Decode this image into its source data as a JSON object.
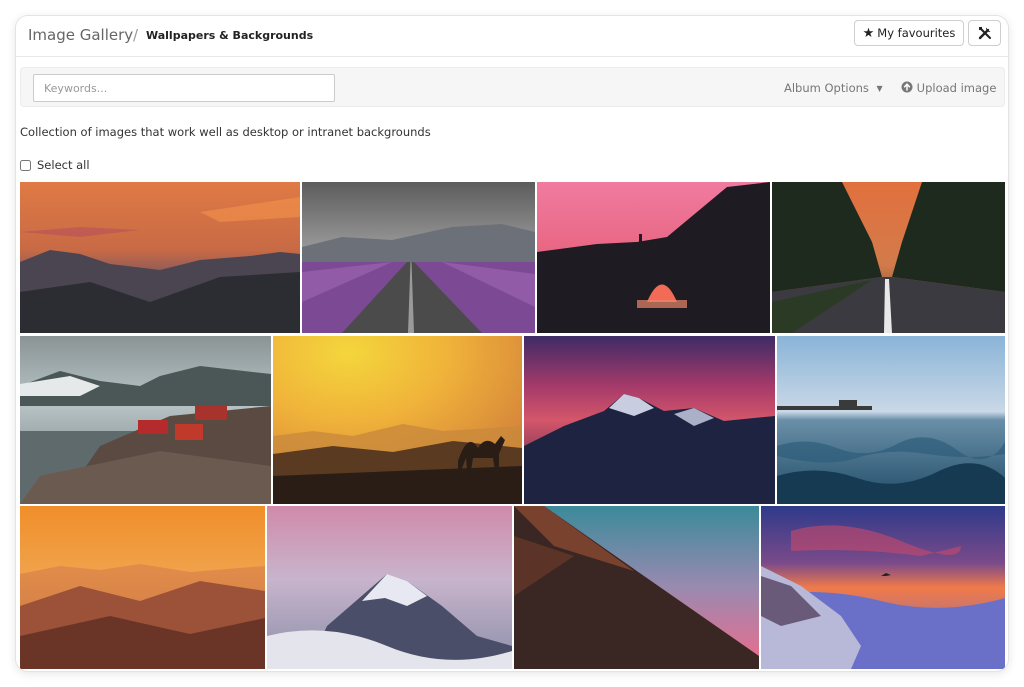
{
  "header": {
    "breadcrumb_root": "Image Gallery",
    "breadcrumb_separator": "/",
    "breadcrumb_current": "Wallpapers & Backgrounds",
    "favourites_label": "My favourites",
    "favourites_icon": "star-icon",
    "tools_icon": "tools-icon"
  },
  "toolbar": {
    "search_placeholder": "Keywords...",
    "album_options_label": "Album Options",
    "upload_label": "Upload image",
    "upload_icon": "upload-circle-icon"
  },
  "album": {
    "description": "Collection of images that work well as desktop or intranet backgrounds",
    "select_all_label": "Select all",
    "select_all_checked": false
  },
  "images": [
    {
      "id": "img-1",
      "subject": "mountain sunset orange sky"
    },
    {
      "id": "img-2",
      "subject": "road through lavender field"
    },
    {
      "id": "img-3",
      "subject": "rock arch silhouette pink sky"
    },
    {
      "id": "img-4",
      "subject": "tree-lined road at sunset"
    },
    {
      "id": "img-5",
      "subject": "coastal village red houses"
    },
    {
      "id": "img-6",
      "subject": "camel desert sunset"
    },
    {
      "id": "img-7",
      "subject": "snowy mountain purple dusk"
    },
    {
      "id": "img-8",
      "subject": "ocean waves pier"
    },
    {
      "id": "img-9",
      "subject": "orange hazy mountains"
    },
    {
      "id": "img-10",
      "subject": "snowy peak above clouds"
    },
    {
      "id": "img-11",
      "subject": "mountain ridge teal pink sky"
    },
    {
      "id": "img-12",
      "subject": "sea of clouds sunrise bird"
    }
  ]
}
